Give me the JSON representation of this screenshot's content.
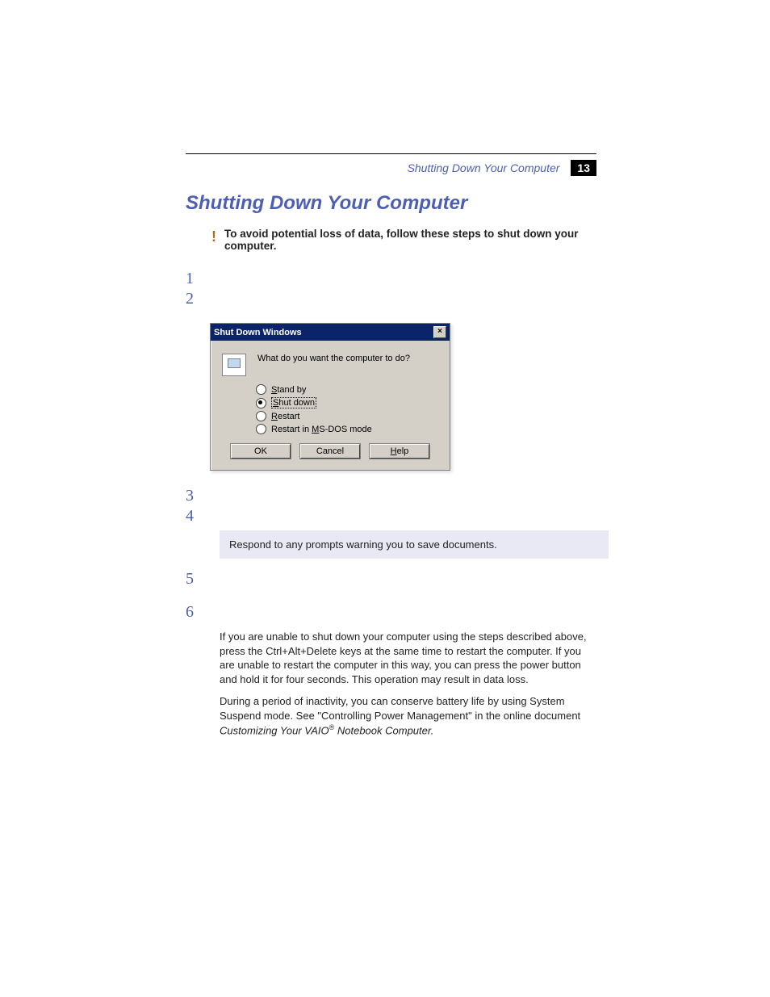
{
  "header": {
    "running_title": "Shutting Down Your Computer",
    "page_number": "13"
  },
  "title": "Shutting Down Your Computer",
  "warning": {
    "marker": "!",
    "text": "To avoid potential loss of data, follow these steps to shut down your computer."
  },
  "steps": {
    "s1": "1",
    "s2": "2",
    "s3": "3",
    "s4": "4",
    "s5": "5",
    "s6": "6"
  },
  "dialog": {
    "title": "Shut Down Windows",
    "close": "×",
    "question": "What do you want the computer to do?",
    "opt_standby_u": "S",
    "opt_standby_rest": "tand by",
    "opt_shutdown_u": "S",
    "opt_shutdown_rest": "hut down",
    "opt_restart_u": "R",
    "opt_restart_rest": "estart",
    "opt_msdos_pre": "Restart in ",
    "opt_msdos_u": "M",
    "opt_msdos_rest": "S-DOS mode",
    "btn_ok": "OK",
    "btn_cancel": "Cancel",
    "btn_help_u": "H",
    "btn_help_rest": "elp"
  },
  "note": "Respond to any prompts warning you to save documents.",
  "para1": "If you are unable to shut down your computer using the steps described above, press the Ctrl+Alt+Delete keys at the same time to restart the computer. If you are unable to restart the computer in this way, you can press the power button and hold it for four seconds. This operation may result in data loss.",
  "para2_a": "During a period of inactivity, you can conserve battery life by using System Suspend mode. See \"Controlling Power Management\" in the online document ",
  "para2_ital": "Customizing Your VAIO",
  "para2_reg": "®",
  "para2_ital2": " Notebook Computer.",
  "colors": {
    "accent": "#4d5fb3"
  }
}
